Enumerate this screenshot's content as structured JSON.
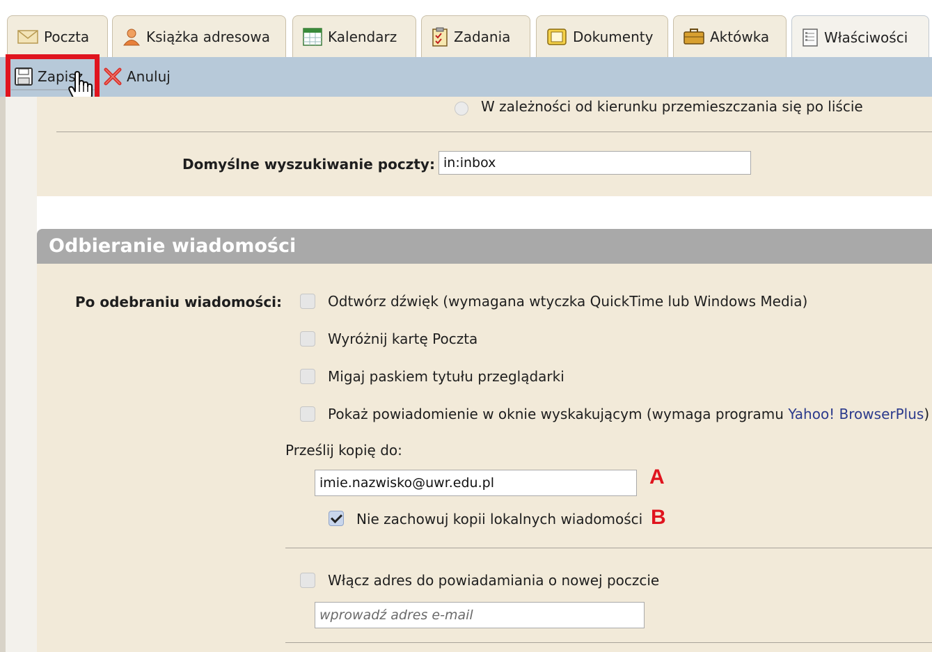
{
  "tabs": [
    {
      "label": "Poczta",
      "icon": "envelope-icon"
    },
    {
      "label": "Książka adresowa",
      "icon": "contacts-icon"
    },
    {
      "label": "Kalendarz",
      "icon": "calendar-icon"
    },
    {
      "label": "Zadania",
      "icon": "tasks-icon"
    },
    {
      "label": "Dokumenty",
      "icon": "documents-icon"
    },
    {
      "label": "Aktówka",
      "icon": "briefcase-icon"
    },
    {
      "label": "Właściwości",
      "icon": "preferences-icon",
      "active": true
    }
  ],
  "toolbar": {
    "save_label": "Zapisz",
    "cancel_label": "Anuluj"
  },
  "top_section": {
    "radio_option": "W zależności od kierunku przemieszczania się po liście",
    "default_search_label": "Domyślne wyszukiwanie poczty:",
    "default_search_value": "in:inbox"
  },
  "receiving": {
    "header": "Odbieranie wiadomości",
    "on_receive_label": "Po odebraniu wiadomości:",
    "options": [
      {
        "label": "Odtwórz dźwięk (wymagana wtyczka QuickTime lub Windows Media)",
        "checked": false
      },
      {
        "label": "Wyróżnij kartę Poczta",
        "checked": false
      },
      {
        "label": "Migaj paskiem tytułu przeglądarki",
        "checked": false
      }
    ],
    "popup_option_prefix": "Pokaż powiadomienie w oknie wyskakującym (wymaga programu ",
    "popup_option_link": "Yahoo! BrowserPlus",
    "popup_option_suffix": ")",
    "forward_label": "Prześlij kopię do:",
    "forward_value": "imie.nazwisko@uwr.edu.pl",
    "marker_a": "A",
    "no_local_copy_label": "Nie zachowuj kopii lokalnych wiadomości",
    "no_local_copy_checked": true,
    "marker_b": "B",
    "notify_address_label": "Włącz adres do powiadamiania o nowej poczcie",
    "notify_address_placeholder": "wprowadź adres e-mail"
  },
  "colors": {
    "panel_bg": "#f2ead9",
    "toolbar_bg": "#b7c9d9",
    "section_header_bg": "#a9a9a9",
    "highlight_red": "#e0141e"
  }
}
